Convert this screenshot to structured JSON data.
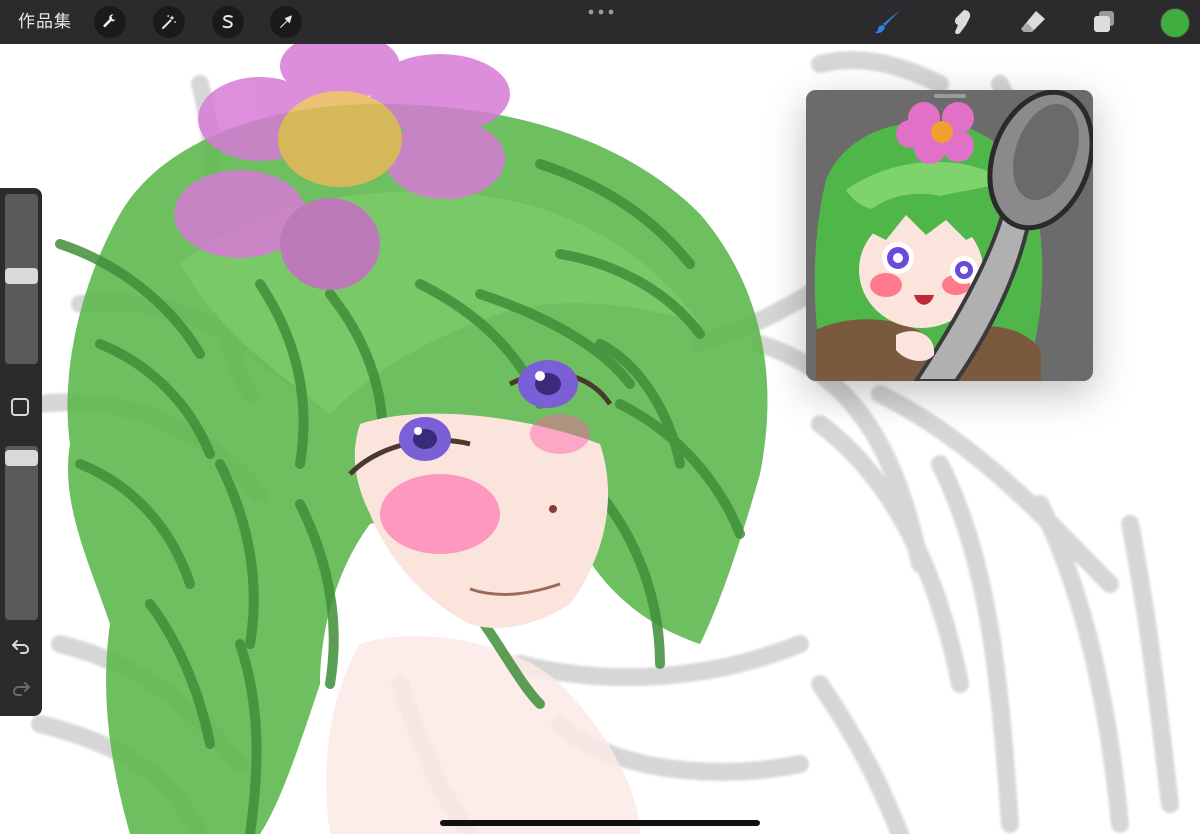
{
  "toolbar": {
    "gallery_label": "作品集",
    "tools_left": [
      {
        "name": "actions",
        "icon": "wrench-icon"
      },
      {
        "name": "adjustments",
        "icon": "magic-wand-icon"
      },
      {
        "name": "selection",
        "icon": "selection-s-icon"
      },
      {
        "name": "transform",
        "icon": "arrow-cursor-icon"
      }
    ],
    "more_icon": "ellipsis-icon",
    "tools_right": [
      {
        "name": "brush",
        "icon": "brush-icon",
        "active_color": "#2f7fe0"
      },
      {
        "name": "smudge",
        "icon": "smudge-finger-icon"
      },
      {
        "name": "eraser",
        "icon": "eraser-icon"
      },
      {
        "name": "layers",
        "icon": "layers-icon"
      }
    ],
    "current_color": "#3fae3f"
  },
  "sidebar": {
    "brush_size_level": 0.52,
    "opacity_level": 0.0,
    "modify_icon": "square-icon",
    "undo_icon": "undo-icon",
    "redo_icon": "redo-icon"
  },
  "canvas": {
    "hair_color": "#49a443",
    "sketch_color": "#c8c8c8",
    "flower_color": "#d77ad6",
    "flower_center_color": "#e8b75a",
    "eye_color": "#7a5fd6",
    "blush_color": "#ff4fae"
  },
  "reference": {
    "background": "#6b6b6b"
  }
}
